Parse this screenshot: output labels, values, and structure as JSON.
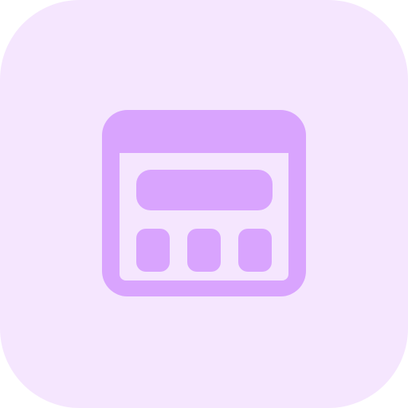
{
  "icon": {
    "name": "browser-layout-icon",
    "colors": {
      "tile_background": "#f5e6fe",
      "glyph": "#d9a4fe"
    }
  }
}
